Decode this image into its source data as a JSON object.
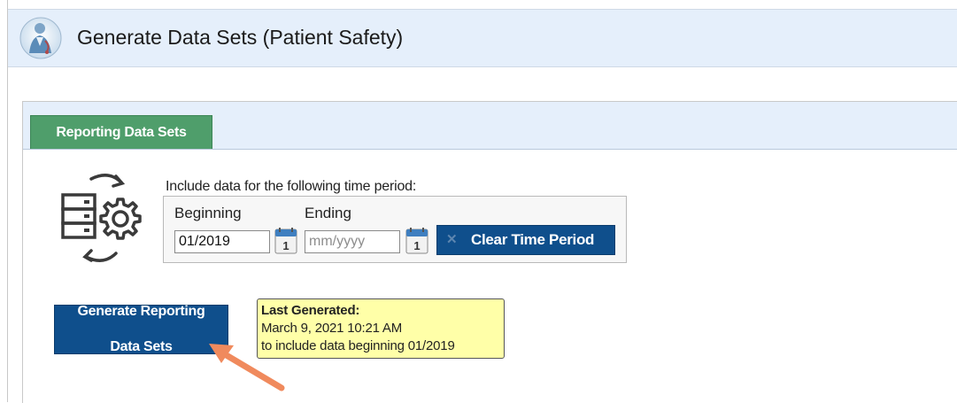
{
  "header": {
    "title": "Generate Data Sets (Patient Safety)",
    "logo_icon": "clinician-logo-icon"
  },
  "tabs": [
    {
      "label": "Reporting Data Sets",
      "active": true,
      "color": "#4f9e6b"
    }
  ],
  "time_period": {
    "instruction": "Include data for the following time period:",
    "beginning_label": "Beginning",
    "ending_label": "Ending",
    "beginning_value": "01/2019",
    "ending_value": "",
    "ending_placeholder": "mm/yyyy",
    "calendar_day": "1",
    "clear_button": "Clear Time Period"
  },
  "generate_button": {
    "line1": "Generate Reporting",
    "line2": "Data Sets"
  },
  "tooltip": {
    "title": "Last Generated:",
    "timestamp": "March 9, 2021 10:21 AM",
    "detail": "to include data beginning 01/2019"
  },
  "colors": {
    "header_bg": "#e5effb",
    "button_blue": "#0f4f8c",
    "tooltip_bg": "#ffffa8",
    "annotation_arrow": "#f08a5d"
  }
}
